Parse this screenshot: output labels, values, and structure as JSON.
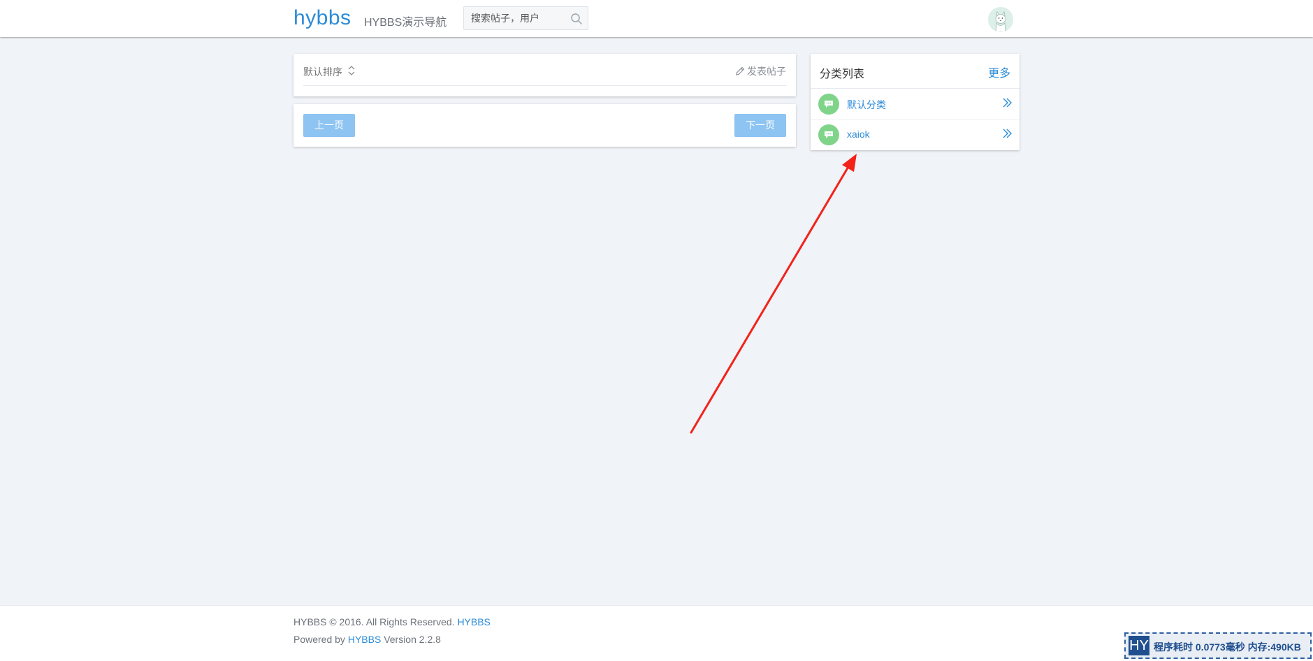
{
  "header": {
    "brand": "hybbs",
    "nav_link": "HYBBS演示导航",
    "search_placeholder": "搜索帖子，用户"
  },
  "toolbar": {
    "sort_label": "默认排序",
    "post_button": "发表帖子"
  },
  "pager": {
    "prev": "上一页",
    "next": "下一页"
  },
  "categories": {
    "title": "分类列表",
    "more": "更多",
    "items": [
      {
        "name": "默认分类"
      },
      {
        "name": "xaiok"
      }
    ]
  },
  "footer": {
    "copyright": "HYBBS © 2016. All Rights Reserved.",
    "copyright_link": "HYBBS",
    "powered_prefix": "Powered by",
    "powered_link": "HYBBS",
    "version": "Version 2.2.8"
  },
  "debug": {
    "logo": "HY",
    "text": "程序耗时 0.0773毫秒 内存:490KB"
  },
  "colors": {
    "accent": "#2b8bd8",
    "button": "#8ec4f2",
    "category_icon": "#7fd48a",
    "annotation_arrow": "#f2231b"
  }
}
